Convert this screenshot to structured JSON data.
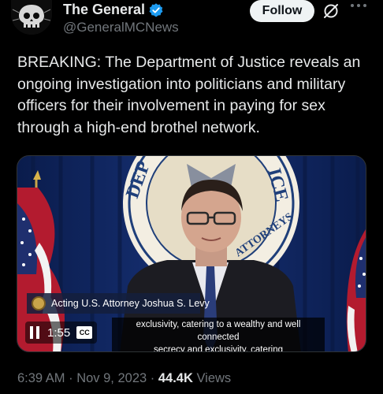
{
  "author": {
    "display_name": "The General",
    "handle": "@GeneralMCNews",
    "verified": true
  },
  "actions": {
    "follow_label": "Follow",
    "grok_icon": "grok-icon",
    "more_icon": "more-icon"
  },
  "tweet": {
    "text": "BREAKING: The Department of Justice reveals an ongoing investigation into politicians and military officers for their involvement in paying for sex through a high-end brothel network."
  },
  "video": {
    "lower_third": "Acting U.S. Attorney Joshua S. Levy",
    "seal_text_left": "DEP",
    "seal_text_right": "ICE",
    "seal_text_bottom": "ATTORNEYS",
    "caption_line1": "exclusivity, catering to a wealthy and well connected",
    "caption_line2": "secrecy and exclusivity, catering",
    "time": "1:55",
    "cc_label": "CC"
  },
  "meta": {
    "timestamp": "6:39 AM · Nov 9, 2023 · ",
    "views_count": "44.4K",
    "views_label": " Views"
  },
  "colors": {
    "background": "#000000",
    "text_primary": "#e7e9ea",
    "text_secondary": "#71767b",
    "verified_blue": "#1d9bf0",
    "follow_bg": "#eff3f4"
  }
}
